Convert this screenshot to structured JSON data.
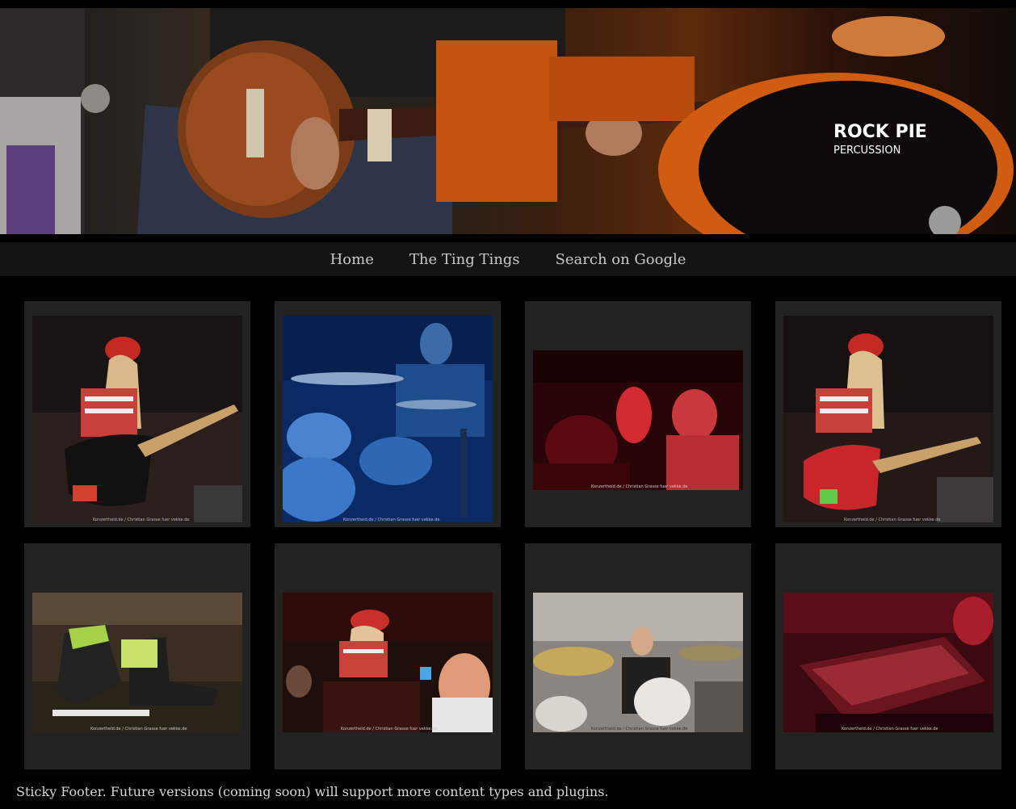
{
  "header": {
    "banner_logo_text": [
      "ROCK PIE",
      "PERCUSSION"
    ]
  },
  "nav": {
    "items": [
      {
        "label": "Home"
      },
      {
        "label": "The Ting Tings"
      },
      {
        "label": "Search on Google"
      }
    ]
  },
  "gallery": {
    "photos": [
      {
        "subject": "guitarist-red-cap-black-guitar",
        "watermark": "Konzertheld.de / Christian Grasse fuer vekke.de"
      },
      {
        "subject": "drummer-blue-light",
        "watermark": "Konzertheld.de / Christian Grasse fuer vekke.de"
      },
      {
        "subject": "crowd-red-light",
        "watermark": "Konzertheld.de / Christian Grasse fuer vekke.de"
      },
      {
        "subject": "guitarist-red-cap-red-guitar",
        "watermark": "Konzertheld.de / Christian Grasse fuer vekke.de"
      },
      {
        "subject": "sneakers-on-stage",
        "watermark": "Konzertheld.de / Christian Grasse fuer vekke.de"
      },
      {
        "subject": "singer-with-crowd",
        "watermark": "Konzertheld.de / Christian Grasse fuer vekke.de"
      },
      {
        "subject": "drummer-white-light",
        "watermark": "Konzertheld.de / Christian Grasse fuer vekke.de"
      },
      {
        "subject": "keyboard-red-light",
        "watermark": "Konzertheld.de / Christian Grasse fuer vekke.de"
      }
    ]
  },
  "footer": {
    "text": "Sticky Footer. Future versions (coming soon) will support more content types and plugins."
  }
}
